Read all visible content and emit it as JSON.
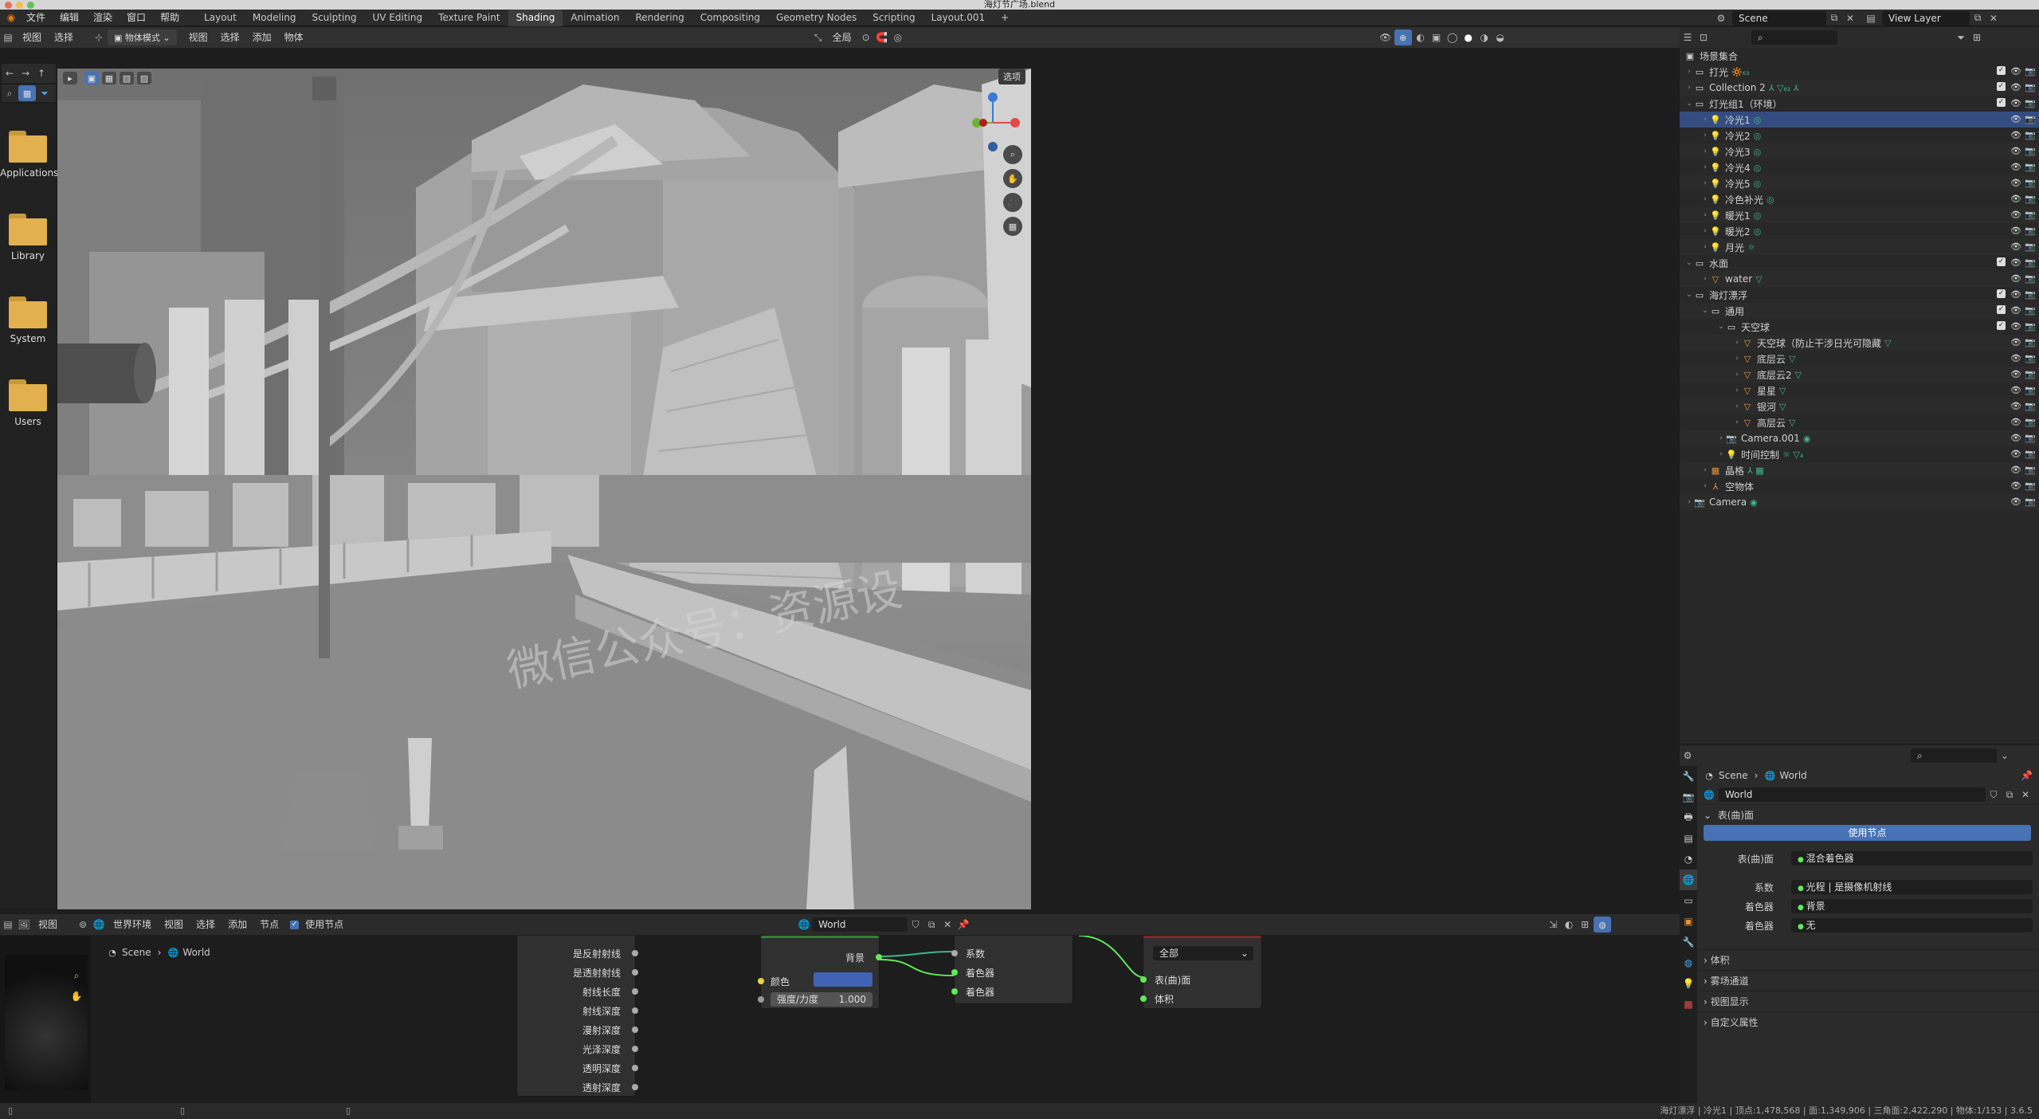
{
  "window": {
    "title": "海灯节广场.blend"
  },
  "menu": [
    "文件",
    "编辑",
    "渲染",
    "窗口",
    "帮助"
  ],
  "workspaces": [
    "Layout",
    "Modeling",
    "Sculpting",
    "UV Editing",
    "Texture Paint",
    "Shading",
    "Animation",
    "Rendering",
    "Compositing",
    "Geometry Nodes",
    "Scripting",
    "Layout.001"
  ],
  "active_workspace": "Shading",
  "scene_selector": {
    "scene": "Scene",
    "view_layer": "View Layer"
  },
  "filebrowser": {
    "header": [
      "视图",
      "选择"
    ],
    "folders": [
      "Applications",
      "Library",
      "System",
      "Users"
    ]
  },
  "viewport": {
    "mode": "物体模式",
    "menus": [
      "视图",
      "选择",
      "添加",
      "物体"
    ],
    "transform_orientation": "全局",
    "options_label": "选项",
    "watermark": "微信公众号：资源设"
  },
  "outliner": {
    "root": "场景集合",
    "rows": [
      {
        "label": "打光",
        "depth": 0,
        "type": "collection",
        "extra": "🔆₆₃",
        "check": true
      },
      {
        "label": "Collection 2",
        "depth": 0,
        "type": "collection",
        "extra": "⅄ ▽₈₂ ⅄",
        "check": true
      },
      {
        "label": "灯光组1（环境）",
        "depth": 0,
        "type": "collection",
        "expanded": true,
        "check": true
      },
      {
        "label": "冷光1",
        "depth": 1,
        "type": "light",
        "extra": "◎",
        "selected": true
      },
      {
        "label": "冷光2",
        "depth": 1,
        "type": "light",
        "extra": "◎"
      },
      {
        "label": "冷光3",
        "depth": 1,
        "type": "light",
        "extra": "◎"
      },
      {
        "label": "冷光4",
        "depth": 1,
        "type": "light",
        "extra": "◎"
      },
      {
        "label": "冷光5",
        "depth": 1,
        "type": "light",
        "extra": "◎"
      },
      {
        "label": "冷色补光",
        "depth": 1,
        "type": "light",
        "extra": "◎"
      },
      {
        "label": "暖光1",
        "depth": 1,
        "type": "light",
        "extra": "◎"
      },
      {
        "label": "暖光2",
        "depth": 1,
        "type": "light",
        "extra": "◎"
      },
      {
        "label": "月光",
        "depth": 1,
        "type": "light",
        "extra": "☼"
      },
      {
        "label": "水面",
        "depth": 0,
        "type": "collection",
        "expanded": true,
        "check": true
      },
      {
        "label": "water",
        "depth": 1,
        "type": "mesh",
        "extra": "▽"
      },
      {
        "label": "海灯漂浮",
        "depth": 0,
        "type": "collection",
        "expanded": true,
        "check": true
      },
      {
        "label": "通用",
        "depth": 1,
        "type": "collection",
        "expanded": true,
        "check": true
      },
      {
        "label": "天空球",
        "depth": 2,
        "type": "collection",
        "expanded": true,
        "check": true
      },
      {
        "label": "天空球（防止干涉日光可隐藏",
        "depth": 3,
        "type": "mesh",
        "extra": "▽"
      },
      {
        "label": "底层云",
        "depth": 3,
        "type": "mesh",
        "extra": "▽"
      },
      {
        "label": "底层云2",
        "depth": 3,
        "type": "mesh",
        "extra": "▽"
      },
      {
        "label": "星星",
        "depth": 3,
        "type": "mesh",
        "extra": "▽"
      },
      {
        "label": "银河",
        "depth": 3,
        "type": "mesh",
        "extra": "▽"
      },
      {
        "label": "高层云",
        "depth": 3,
        "type": "mesh",
        "extra": "▽"
      },
      {
        "label": "Camera.001",
        "depth": 2,
        "type": "camera",
        "extra": "◉"
      },
      {
        "label": "时间控制",
        "depth": 2,
        "type": "light",
        "extra": "☼ ▽₄"
      },
      {
        "label": "晶格",
        "depth": 1,
        "type": "lattice",
        "extra": "⅄ ▦"
      },
      {
        "label": "空物体",
        "depth": 1,
        "type": "empty",
        "extra": ""
      },
      {
        "label": "Camera",
        "depth": 0,
        "type": "camera",
        "extra": "◉"
      }
    ]
  },
  "properties": {
    "breadcrumb": [
      "Scene",
      "World"
    ],
    "world_name": "World",
    "surface_panel": "表(曲)面",
    "use_nodes_button": "使用节点",
    "fields": [
      {
        "label": "表(曲)面",
        "value": "混合着色器"
      },
      {
        "label": "系数",
        "value": "光程 | 是摄像机射线"
      },
      {
        "label": "着色器",
        "value": "背景"
      },
      {
        "label": "着色器",
        "value": "无"
      }
    ],
    "collapsed_panels": [
      "体积",
      "雾场通道",
      "视图显示",
      "自定义属性"
    ]
  },
  "node_editor": {
    "header": {
      "mode": "世界环境",
      "menus": [
        "视图",
        "选择",
        "添加",
        "节点"
      ],
      "use_nodes": "使用节点",
      "datablock": "World"
    },
    "breadcrumb": [
      "Scene",
      "World"
    ],
    "lightpath_outputs": [
      "是反射射线",
      "是透射射线",
      "射线长度",
      "射线深度",
      "漫射深度",
      "光泽深度",
      "透明深度",
      "透射深度"
    ],
    "background_node": {
      "output": "背景",
      "color_label": "颜色",
      "strength_label": "强度/力度",
      "strength_value": "1.000"
    },
    "mix_node": {
      "inputs": [
        "系数",
        "着色器",
        "着色器"
      ]
    },
    "output_node": {
      "target": "全部",
      "inputs": [
        "表(曲)面",
        "体积"
      ]
    }
  },
  "statusbar": {
    "text": "海灯漂浮 | 冷光1 | 顶点:1,478,568 | 面:1,349,906 | 三角面:2,422,290 | 物体:1/153 | 3.6.5"
  },
  "colors": {
    "accent": "#4772b3",
    "selected_row": "#334d80",
    "light_icon": "#e8913a",
    "mesh_icon": "#e88f3a",
    "data_icon": "#3fb58a"
  }
}
